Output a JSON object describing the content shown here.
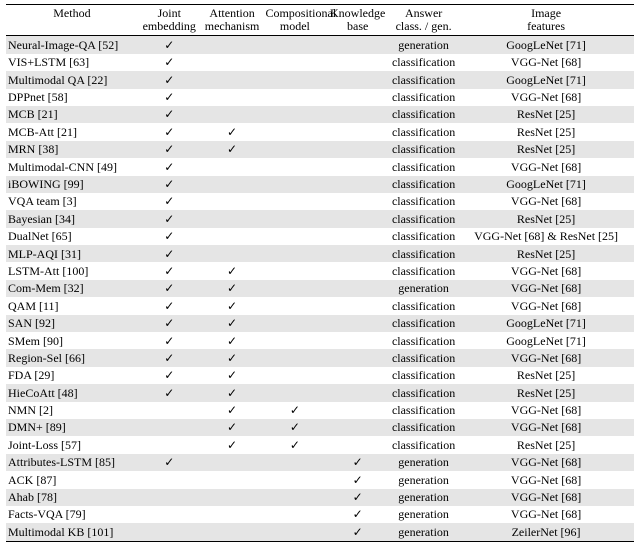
{
  "chart_data": {
    "type": "table",
    "columns": [
      "Method",
      "Joint embedding",
      "Attention mechanism",
      "Compositional model",
      "Knowledge base",
      "Answer class. / gen.",
      "Image features"
    ],
    "rows": [
      [
        "Neural-Image-QA [52]",
        true,
        false,
        false,
        false,
        "generation",
        "GoogLeNet [71]"
      ],
      [
        "VIS+LSTM [63]",
        true,
        false,
        false,
        false,
        "classification",
        "VGG-Net [68]"
      ],
      [
        "Multimodal QA [22]",
        true,
        false,
        false,
        false,
        "classification",
        "GoogLeNet [71]"
      ],
      [
        "DPPnet [58]",
        true,
        false,
        false,
        false,
        "classification",
        "VGG-Net [68]"
      ],
      [
        "MCB [21]",
        true,
        false,
        false,
        false,
        "classification",
        "ResNet [25]"
      ],
      [
        "MCB-Att [21]",
        true,
        true,
        false,
        false,
        "classification",
        "ResNet [25]"
      ],
      [
        "MRN [38]",
        true,
        true,
        false,
        false,
        "classification",
        "ResNet [25]"
      ],
      [
        "Multimodal-CNN [49]",
        true,
        false,
        false,
        false,
        "classification",
        "VGG-Net [68]"
      ],
      [
        "iBOWING [99]",
        true,
        false,
        false,
        false,
        "classification",
        "GoogLeNet [71]"
      ],
      [
        "VQA team [3]",
        true,
        false,
        false,
        false,
        "classification",
        "VGG-Net [68]"
      ],
      [
        "Bayesian [34]",
        true,
        false,
        false,
        false,
        "classification",
        "ResNet [25]"
      ],
      [
        "DualNet [65]",
        true,
        false,
        false,
        false,
        "classification",
        "VGG-Net [68] & ResNet [25]"
      ],
      [
        "MLP-AQI [31]",
        true,
        false,
        false,
        false,
        "classification",
        "ResNet [25]"
      ],
      [
        "LSTM-Att [100]",
        true,
        true,
        false,
        false,
        "classification",
        "VGG-Net [68]"
      ],
      [
        "Com-Mem [32]",
        true,
        true,
        false,
        false,
        "generation",
        "VGG-Net [68]"
      ],
      [
        "QAM [11]",
        true,
        true,
        false,
        false,
        "classification",
        "VGG-Net [68]"
      ],
      [
        "SAN [92]",
        true,
        true,
        false,
        false,
        "classification",
        "GoogLeNet [71]"
      ],
      [
        "SMem [90]",
        true,
        true,
        false,
        false,
        "classification",
        "GoogLeNet [71]"
      ],
      [
        "Region-Sel [66]",
        true,
        true,
        false,
        false,
        "classification",
        "VGG-Net [68]"
      ],
      [
        "FDA [29]",
        true,
        true,
        false,
        false,
        "classification",
        "ResNet [25]"
      ],
      [
        "HieCoAtt [48]",
        true,
        true,
        false,
        false,
        "classification",
        "ResNet [25]"
      ],
      [
        "NMN [2]",
        false,
        true,
        true,
        false,
        "classification",
        "VGG-Net [68]"
      ],
      [
        "DMN+ [89]",
        false,
        true,
        true,
        false,
        "classification",
        "VGG-Net [68]"
      ],
      [
        "Joint-Loss [57]",
        false,
        true,
        true,
        false,
        "classification",
        "ResNet [25]"
      ],
      [
        "Attributes-LSTM [85]",
        true,
        false,
        false,
        true,
        "generation",
        "VGG-Net [68]"
      ],
      [
        "ACK [87]",
        false,
        false,
        false,
        true,
        "generation",
        "VGG-Net [68]"
      ],
      [
        "Ahab [78]",
        false,
        false,
        false,
        true,
        "generation",
        "VGG-Net [68]"
      ],
      [
        "Facts-VQA [79]",
        false,
        false,
        false,
        true,
        "generation",
        "VGG-Net [68]"
      ],
      [
        "Multimodal KB [101]",
        false,
        false,
        false,
        true,
        "generation",
        "ZeilerNet [96]"
      ]
    ]
  },
  "header": {
    "method": "Method",
    "joint1": "Joint",
    "joint2": "embedding",
    "att1": "Attention",
    "att2": "mechanism",
    "comp1": "Compositional",
    "comp2": "model",
    "kb1": "Knowledge",
    "kb2": "base",
    "ans1": "Answer",
    "ans2": "class. / gen.",
    "img1": "Image",
    "img2": "features"
  },
  "check_glyph": "✓"
}
